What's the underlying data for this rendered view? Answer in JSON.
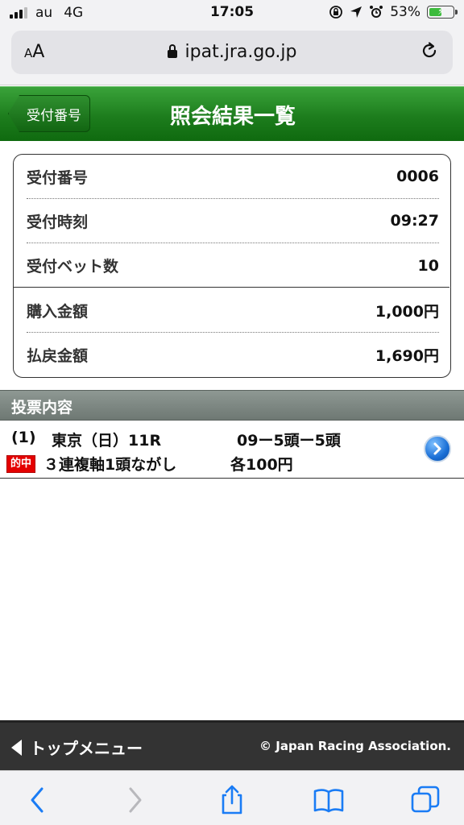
{
  "status_bar": {
    "carrier": "au",
    "network": "4G",
    "time": "17:05",
    "battery": "53%"
  },
  "browser": {
    "text_size_label": "AA",
    "url": "ipat.jra.go.jp"
  },
  "header": {
    "back_label": "受付番号",
    "title": "照会結果一覧"
  },
  "summary": {
    "rows": [
      {
        "label": "受付番号",
        "value": "0006"
      },
      {
        "label": "受付時刻",
        "value": "09:27"
      },
      {
        "label": "受付ベット数",
        "value": "10"
      },
      {
        "label": "購入金額",
        "value": "1,000円"
      },
      {
        "label": "払戻金額",
        "value": "1,690円"
      }
    ]
  },
  "section": {
    "title": "投票内容"
  },
  "bet": {
    "number": "(1)",
    "race": "東京（日）11R",
    "detail": "09ー5頭ー5頭",
    "hit_badge": "的中",
    "type": "３連複軸1頭ながし",
    "amount": "各100円"
  },
  "footer": {
    "top_menu": "トップメニュー",
    "copyright": "© Japan Racing Association."
  },
  "colors": {
    "header_green": "#1d7d1d",
    "hit_red": "#e40000",
    "ios_blue": "#1a7cf5"
  }
}
